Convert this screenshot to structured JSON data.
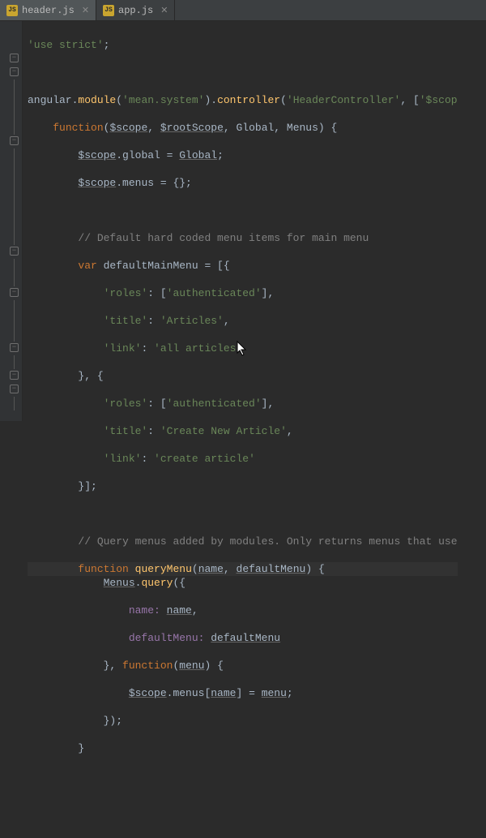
{
  "tabs": [
    {
      "label": "header.js",
      "icon": "JS",
      "active": true
    },
    {
      "label": "app.js",
      "icon": "JS",
      "active": false
    }
  ],
  "code": {
    "l1": "'use strict'",
    "l3a": "angular.",
    "l3b": "module",
    "l3c": "(",
    "l3d": "'mean.system'",
    "l3e": ").",
    "l3f": "controller",
    "l3g": "(",
    "l3h": "'HeaderController'",
    "l3i": ", [",
    "l3j": "'$scop",
    "l4a": "function",
    "l4b": "(",
    "l4c": "$scope",
    "l4d": ", ",
    "l4e": "$rootScope",
    "l4f": ", Global, Menus) {",
    "l5a": "$scope",
    "l5b": ".global = ",
    "l5c": "Global",
    "l5d": ";",
    "l6a": "$scope",
    "l6b": ".menus = {};",
    "l8": "// Default hard coded menu items for main menu",
    "l9a": "var",
    "l9b": " defaultMainMenu = [{",
    "l10a": "'roles'",
    "l10b": ": [",
    "l10c": "'authenticated'",
    "l10d": "],",
    "l11a": "'title'",
    "l11b": ": ",
    "l11c": "'Articles'",
    "l11d": ",",
    "l12a": "'link'",
    "l12b": ": ",
    "l12c": "'all articles'",
    "l13": "}, {",
    "l14a": "'roles'",
    "l14b": ": [",
    "l14c": "'authenticated'",
    "l14d": "],",
    "l15a": "'title'",
    "l15b": ": ",
    "l15c": "'Create New Article'",
    "l15d": ",",
    "l16a": "'link'",
    "l16b": ": ",
    "l16c": "'create article'",
    "l17": "}];",
    "l19": "// Query menus added by modules. Only returns menus that use",
    "l20a": "function",
    "l20b": " ",
    "l20c": "queryMenu",
    "l20d": "(",
    "l20e": "name",
    "l20f": ", ",
    "l20g": "defaultMenu",
    "l20h": ") {",
    "l21a": "Menus",
    "l21b": ".",
    "l21c": "query",
    "l21d": "({",
    "l22a": "name: ",
    "l22b": "name",
    "l22c": ",",
    "l23a": "defaultMenu: ",
    "l23b": "defaultMenu",
    "l24a": "}, ",
    "l24b": "function",
    "l24c": "(",
    "l24d": "menu",
    "l24e": ") {",
    "l25a": "$scope",
    "l25b": ".menus[",
    "l25c": "name",
    "l25d": "] = ",
    "l25e": "menu",
    "l25f": ";",
    "l26": "});",
    "l27": "}"
  }
}
